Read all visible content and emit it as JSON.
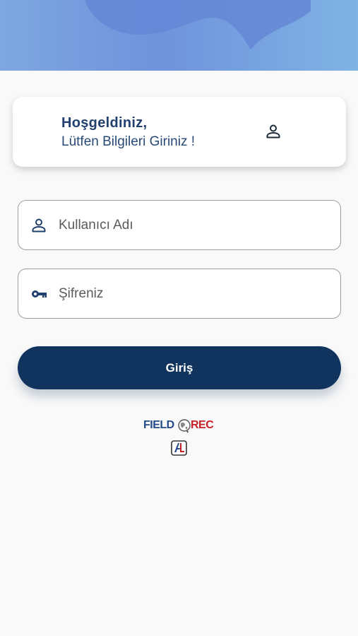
{
  "welcome": {
    "title": "Hoşgeldiniz,",
    "subtitle": "Lütfen Bilgileri Giriniz !"
  },
  "login_form": {
    "username_placeholder": "Kullanıcı Adı",
    "password_placeholder": "Şifreniz",
    "submit_label": "Giriş"
  },
  "logos": {
    "brand_text_left": "FIELD",
    "brand_text_right": "REC",
    "brand_monogram": "AL"
  },
  "icons": {
    "card_icon": "person-icon",
    "username_icon": "person-icon",
    "password_icon": "key-icon"
  },
  "colors": {
    "primary": "#11345f",
    "banner_blue": "#6f93dc",
    "title_text": "#22406e",
    "brand_blue": "#244a8a",
    "brand_red": "#c72027"
  }
}
